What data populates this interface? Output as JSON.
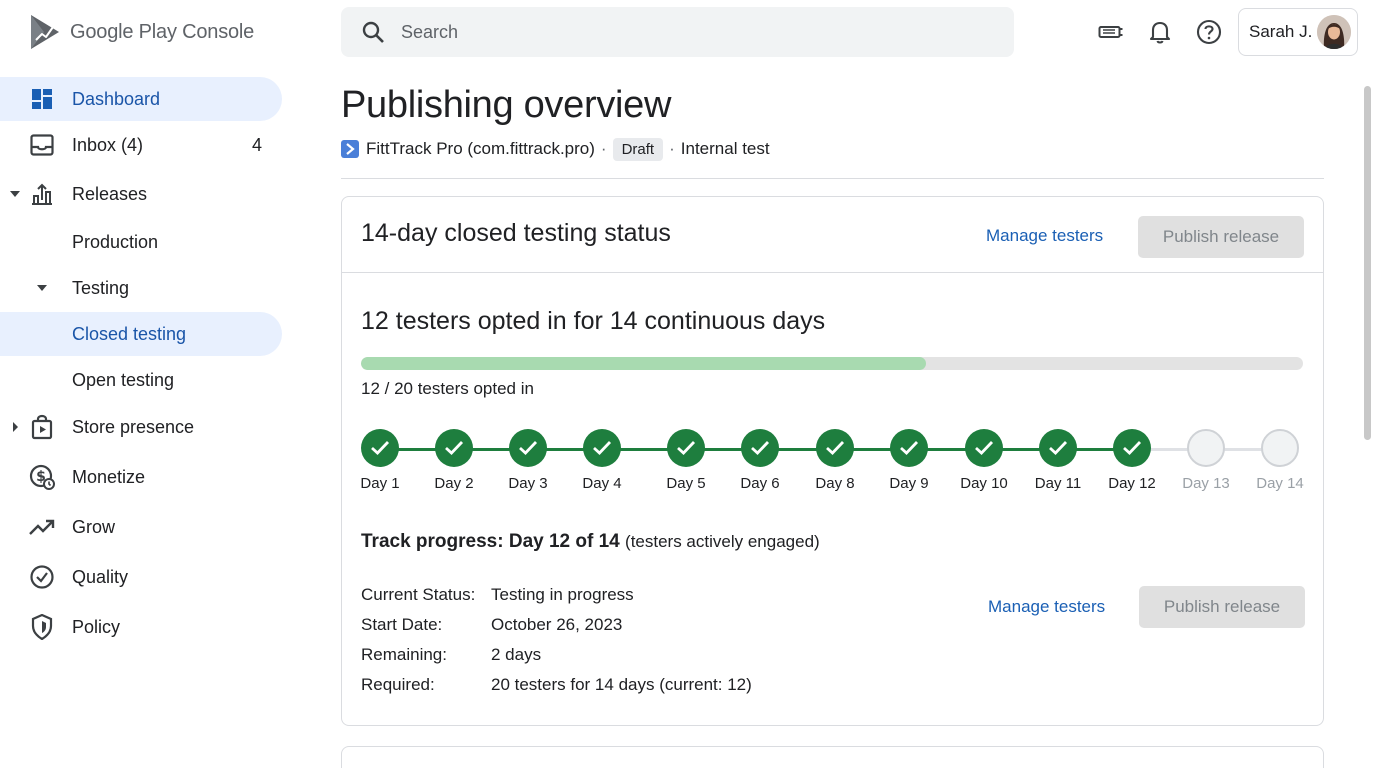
{
  "brand": {
    "name": "Google Play Console"
  },
  "sidebar": {
    "items": [
      {
        "label": "Dashboard",
        "icon": "dashboard-icon",
        "active": true
      },
      {
        "label": "Inbox (4)",
        "icon": "inbox-icon",
        "count": "4"
      },
      {
        "label": "Releases",
        "icon": "releases-icon",
        "expanded": true
      },
      {
        "label": "Production"
      },
      {
        "label": "Testing",
        "expanded": true
      },
      {
        "label": "Closed testing",
        "active": true
      },
      {
        "label": "Open testing"
      },
      {
        "label": "Store presence",
        "icon": "store-presence-icon",
        "expanded": false
      },
      {
        "label": "Monetize",
        "icon": "monetize-icon"
      },
      {
        "label": "Grow",
        "icon": "grow-icon"
      },
      {
        "label": "Quality",
        "icon": "quality-icon"
      },
      {
        "label": "Policy",
        "icon": "policy-icon"
      }
    ]
  },
  "topbar": {
    "search_placeholder": "Search",
    "user_name": "Sarah J.",
    "icons": [
      "cast-icon",
      "notifications-icon",
      "help-icon"
    ]
  },
  "page": {
    "title": "Publishing overview",
    "app_name": "FittTrack Pro (com.fittrack.pro)",
    "separator": "·",
    "status_badge": "Draft",
    "track": "Internal test"
  },
  "card": {
    "title": "14-day closed testing status",
    "manage_testers": "Manage testers",
    "publish_release": "Publish release",
    "headline": "12 testers opted in for 14 continuous days",
    "progress": {
      "current": 12,
      "total": 20
    },
    "progress_label": "12 / 20 testers opted in",
    "days": [
      {
        "label": "Day 1",
        "done": true
      },
      {
        "label": "Day 2",
        "done": true
      },
      {
        "label": "Day 3",
        "done": true
      },
      {
        "label": "Day 4",
        "done": true
      },
      {
        "label": "Day 5",
        "done": true
      },
      {
        "label": "Day 6",
        "done": true
      },
      {
        "label": "Day 8",
        "done": true
      },
      {
        "label": "Day 9",
        "done": true
      },
      {
        "label": "Day 10",
        "done": true
      },
      {
        "label": "Day 11",
        "done": true
      },
      {
        "label": "Day 12",
        "done": true
      },
      {
        "label": "Day 13",
        "done": false
      },
      {
        "label": "Day 14",
        "done": false
      }
    ],
    "track_progress_bold": "Track progress: Day 12 of 14",
    "track_progress_sub": "(testers actively engaged)",
    "details": [
      {
        "key": "Current Status:",
        "value": "Testing in progress"
      },
      {
        "key": "Start Date:",
        "value": "October 26, 2023"
      },
      {
        "key": "Remaining:",
        "value": "2 days"
      },
      {
        "key": "Required:",
        "value": "20 testers for 14 days (current: 12)"
      }
    ],
    "manage_testers_2": "Manage testers",
    "publish_release_2": "Publish release"
  },
  "colors": {
    "accent": "#1a5fb4",
    "active_nav_bg": "#e8f0fe",
    "done_green": "#1e7e3e",
    "progress_fill": "#a8dab0",
    "disabled_button": "#e0e0e0"
  }
}
